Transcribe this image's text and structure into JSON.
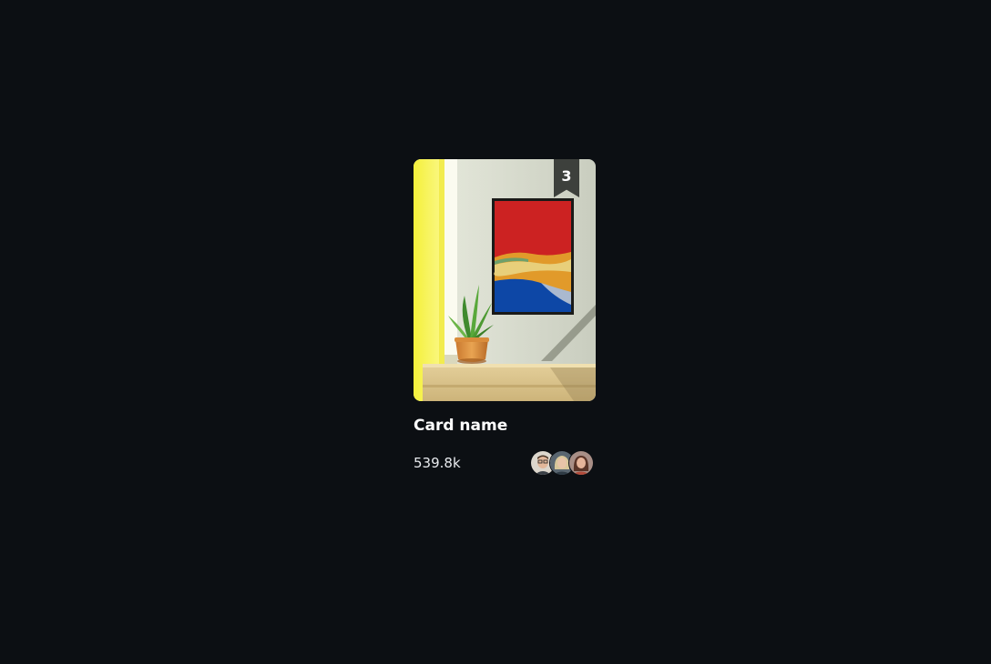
{
  "card": {
    "rank": "3",
    "title": "Card name",
    "count": "539.8k",
    "image_icon": "room-painting-plant-image",
    "avatars": [
      {
        "icon": "avatar-man-glasses"
      },
      {
        "icon": "avatar-woman-blonde"
      },
      {
        "icon": "avatar-woman-dark-hair"
      }
    ]
  },
  "colors": {
    "background": "#0c0f13",
    "badge": "#3d403c",
    "title": "#ffffff"
  }
}
